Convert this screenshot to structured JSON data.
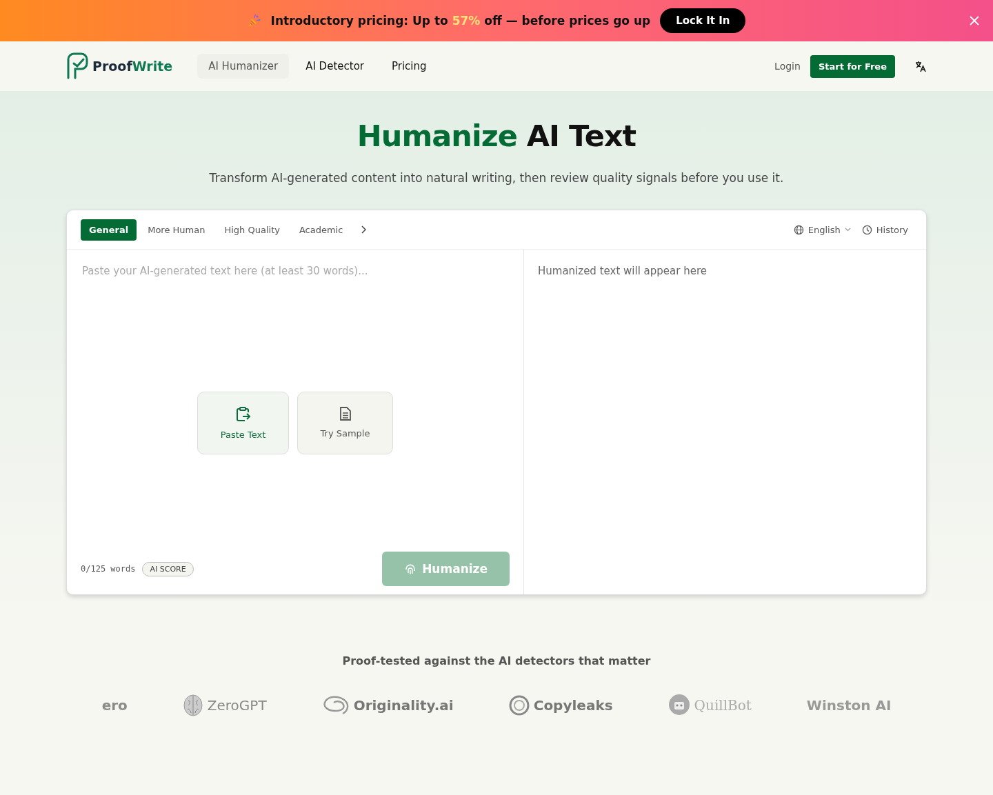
{
  "banner": {
    "text_before": "Introductory pricing: Up to",
    "highlight": "57%",
    "text_after": "off — before prices go up",
    "button": "Lock It In"
  },
  "header": {
    "logo_part1": "Proof",
    "logo_part2": "Write",
    "nav": [
      {
        "label": "AI Humanizer",
        "selected": true
      },
      {
        "label": "AI Detector",
        "selected": false
      },
      {
        "label": "Pricing",
        "selected": false
      }
    ],
    "login": "Login",
    "cta": "Start for Free"
  },
  "hero": {
    "title_accent": "Humanize",
    "title_rest": "AI Text",
    "subtitle": "Transform AI-generated content into natural writing, then review quality signals before you use it."
  },
  "editor": {
    "modes": [
      {
        "label": "General",
        "selected": true
      },
      {
        "label": "More Human",
        "selected": false
      },
      {
        "label": "High Quality",
        "selected": false
      },
      {
        "label": "Academic",
        "selected": false
      }
    ],
    "language": "English",
    "history": "History",
    "input": {
      "placeholder": "Paste your AI-generated text here (at least 30 words)..."
    },
    "actions": [
      {
        "kind": "paste",
        "label": "Paste Text"
      },
      {
        "kind": "sample",
        "label": "Try Sample"
      }
    ],
    "word_count": "0/125 words",
    "ai_score": "AI SCORE",
    "humanize": "Humanize",
    "humanize_disabled": true,
    "output_placeholder": "Humanized text will appear here"
  },
  "detectors": {
    "heading": "Proof-tested against the AI detectors that matter",
    "logos": [
      {
        "kind": "faded",
        "name": "ero"
      },
      {
        "kind": "brain",
        "name": "ZeroGPT"
      },
      {
        "kind": "swirl",
        "name": "Originality.ai"
      },
      {
        "kind": "ring",
        "name": "Copyleaks"
      },
      {
        "kind": "robot",
        "name": "QuillBot"
      },
      {
        "kind": "plain",
        "name": "Winston AI"
      }
    ]
  }
}
